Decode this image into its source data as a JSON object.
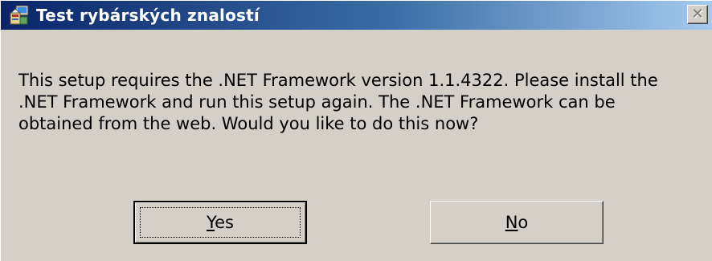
{
  "window": {
    "title": "Test rybárských znalostí",
    "close_glyph": "✕",
    "icon": "setup-installer-icon"
  },
  "message": {
    "lines": [
      "This setup requires the .NET Framework version 1.1.4322.  Please install the",
      ".NET Framework and run this setup again.  The .NET Framework can be",
      "obtained from the web.  Would you like to do this now?"
    ]
  },
  "buttons": {
    "yes": {
      "mnemonic": "Y",
      "rest": "es"
    },
    "no": {
      "mnemonic": "N",
      "rest": "o"
    }
  },
  "colors": {
    "face": "#d4d0c8",
    "title_start": "#0a246a",
    "title_end": "#a6caf0"
  }
}
